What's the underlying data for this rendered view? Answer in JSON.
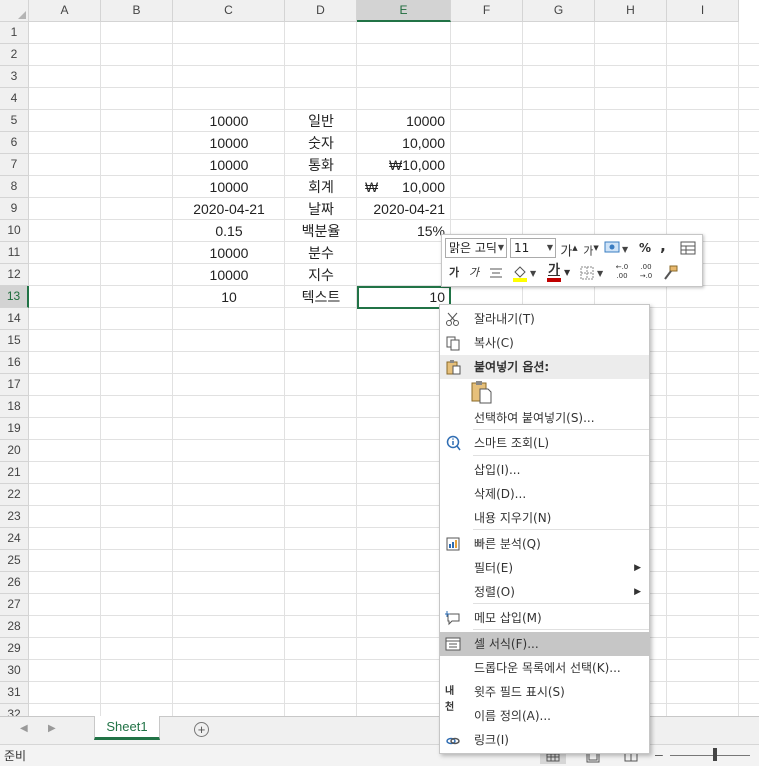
{
  "columns": [
    "A",
    "B",
    "C",
    "D",
    "E",
    "F",
    "G",
    "H",
    "I"
  ],
  "selected_column": "E",
  "rows": [
    "1",
    "2",
    "3",
    "4",
    "5",
    "6",
    "7",
    "8",
    "9",
    "10",
    "11",
    "12",
    "13",
    "14",
    "15",
    "16",
    "17",
    "18",
    "19",
    "20",
    "21",
    "22",
    "23",
    "24",
    "25",
    "26",
    "27",
    "28",
    "29",
    "30",
    "31",
    "32"
  ],
  "selected_row": "13",
  "cells": {
    "C5": "10000",
    "D5": "일반",
    "E5": "10000",
    "C6": "10000",
    "D6": "숫자",
    "E6": "10,000",
    "C7": "10000",
    "D7": "통화",
    "E7": "₩10,000",
    "C8": "10000",
    "D8": "회계",
    "E8_symbol": "₩",
    "E8": "10,000",
    "C9": "2020-04-21",
    "D9": "날짜",
    "E9": "2020-04-21",
    "C10": "0.15",
    "D10": "백분율",
    "E10": "15%",
    "C11": "10000",
    "D11": "분수",
    "C12": "10000",
    "D12": "지수",
    "C13": "10",
    "D13": "텍스트",
    "E13": "10"
  },
  "sheet_tabs": [
    "Sheet1"
  ],
  "add_sheet_label": "+",
  "status": {
    "ready": "준비"
  },
  "mini_toolbar": {
    "font_name": "맑은 고딕",
    "font_size": "11",
    "grow_font": "가",
    "shrink_font": "가",
    "percent": "%",
    "comma": ",",
    "bold": "가",
    "italic": "가",
    "font_color_letter": "가",
    "increase_decimal": "←.0 .00",
    "decrease_decimal": ".00 →.0",
    "fill_color": "#ffff00",
    "font_color": "#c00000"
  },
  "context_menu": {
    "items": [
      {
        "label": "잘라내기(T)",
        "icon": "scissors-icon"
      },
      {
        "label": "복사(C)",
        "icon": "copy-icon"
      },
      {
        "label": "붙여넣기 옵션:",
        "icon": "paste-icon"
      },
      {
        "label": "선택하여 붙여넣기(S)...",
        "icon": ""
      },
      {
        "label": "스마트 조회(L)",
        "icon": "smart-lookup-icon"
      },
      {
        "label": "삽입(I)...",
        "icon": ""
      },
      {
        "label": "삭제(D)...",
        "icon": ""
      },
      {
        "label": "내용 지우기(N)",
        "icon": ""
      },
      {
        "label": "빠른 분석(Q)",
        "icon": "quick-analysis-icon"
      },
      {
        "label": "필터(E)",
        "icon": "",
        "submenu": "▶"
      },
      {
        "label": "정렬(O)",
        "icon": "",
        "submenu": "▶"
      },
      {
        "label": "메모 삽입(M)",
        "icon": "comment-icon"
      },
      {
        "label": "셀 서식(F)...",
        "icon": "format-cells-icon"
      },
      {
        "label": "드롭다운 목록에서 선택(K)...",
        "icon": ""
      },
      {
        "label": "윗주 필드 표시(S)",
        "icon": "phonetic-icon"
      },
      {
        "label": "이름 정의(A)...",
        "icon": ""
      },
      {
        "label": "링크(I)",
        "icon": "link-icon"
      }
    ],
    "highlighted": "셀 서식(F)...",
    "phonetic_icon_text": "내천"
  }
}
